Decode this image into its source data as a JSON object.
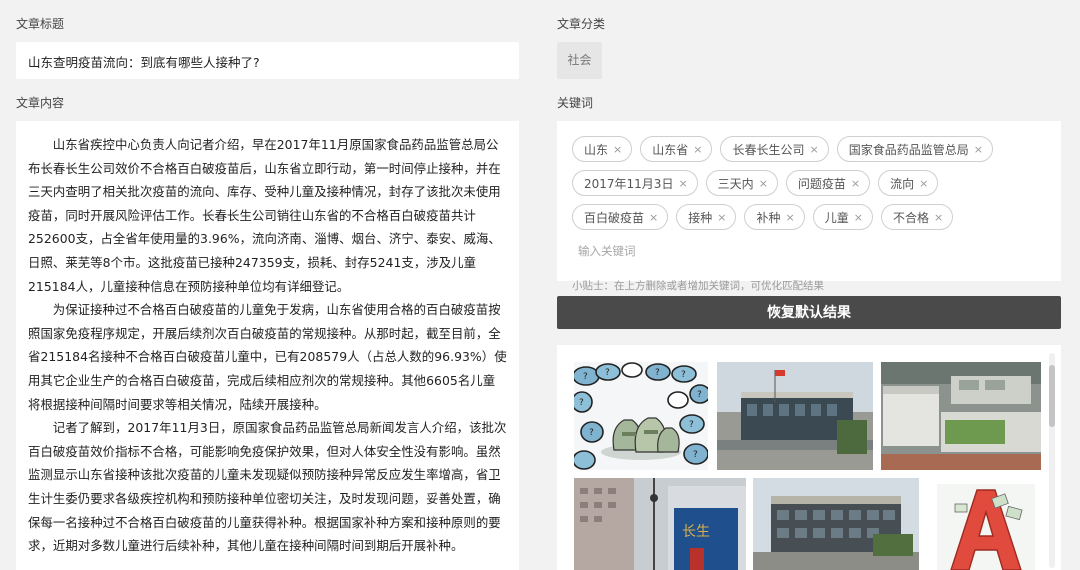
{
  "labels": {
    "title": "文章标题",
    "category": "文章分类",
    "content": "文章内容",
    "keywords": "关键词"
  },
  "article": {
    "title": "山东查明疫苗流向：到底有哪些人接种了?",
    "category": "社会",
    "paragraphs": [
      "山东省疾控中心负责人向记者介绍，早在2017年11月原国家食品药品监管总局公布长春长生公司效价不合格百白破疫苗后，山东省立即行动，第一时间停止接种，并在三天内查明了相关批次疫苗的流向、库存、受种儿童及接种情况，封存了该批次未使用疫苗，同时开展风险评估工作。长春长生公司销往山东省的不合格百白破疫苗共计252600支，占全省年使用量的3.96%，流向济南、淄博、烟台、济宁、泰安、威海、日照、莱芜等8个市。这批疫苗已接种247359支，损耗、封存5241支，涉及儿童215184人，儿童接种信息在预防接种单位均有详细登记。",
      "为保证接种过不合格百白破疫苗的儿童免于发病，山东省使用合格的百白破疫苗按照国家免疫程序规定，开展后续剂次百白破疫苗的常规接种。从那时起，截至目前，全省215184名接种不合格百白破疫苗儿童中，已有208579人（占总人数的96.93%）使用其它企业生产的合格百白破疫苗，完成后续相应剂次的常规接种。其他6605名儿童将根据接种间隔时间要求等相关情况，陆续开展接种。",
      "记者了解到，2017年11月3日，原国家食品药品监管总局新闻发言人介绍，该批次百白破疫苗效价指标不合格，可能影响免疫保护效果，但对人体安全性没有影响。虽然监测显示山东省接种该批次疫苗的儿童未发现疑似预防接种异常反应发生率增高，省卫生计生委仍要求各级疾控机构和预防接种单位密切关注，及时发现问题，妥善处置，确保每一名接种过不合格百白破疫苗的儿童获得补种。根据国家补种方案和接种原则的要求，近期对多数儿童进行后续补种，其他儿童在接种间隔时间到期后开展补种。"
    ]
  },
  "keywords": {
    "tags": [
      "山东",
      "山东省",
      "长春长生公司",
      "国家食品药品监管总局",
      "2017年11月3日",
      "三天内",
      "问题疫苗",
      "流向",
      "百白破疫苗",
      "接种",
      "补种",
      "儿童",
      "不合格"
    ],
    "remove_icon": "close-icon",
    "remove_glyph": "×",
    "input_placeholder": "输入关键词",
    "tip": "小贴士：在上方删除或者增加关键词，可优化匹配结果"
  },
  "restore_button": "恢复默认结果",
  "images": [
    {
      "name": "cartoon-vaccine-money-image",
      "depicts": "cartoon of vaccine vials and money bags"
    },
    {
      "name": "factory-gate-image",
      "depicts": "company gate with red flag"
    },
    {
      "name": "aerial-factory-image",
      "depicts": "aerial view of factory campus"
    },
    {
      "name": "company-sign-image",
      "depicts": "company signage near building"
    },
    {
      "name": "office-building-image",
      "depicts": "office building facade"
    },
    {
      "name": "cartoon-letter-a-image",
      "depicts": "cartoon red letter A sculpture"
    }
  ],
  "colors": {
    "page_bg": "#f2f2f2",
    "button_bg": "#4a4a4a",
    "tag_border": "#cfcfcf"
  }
}
